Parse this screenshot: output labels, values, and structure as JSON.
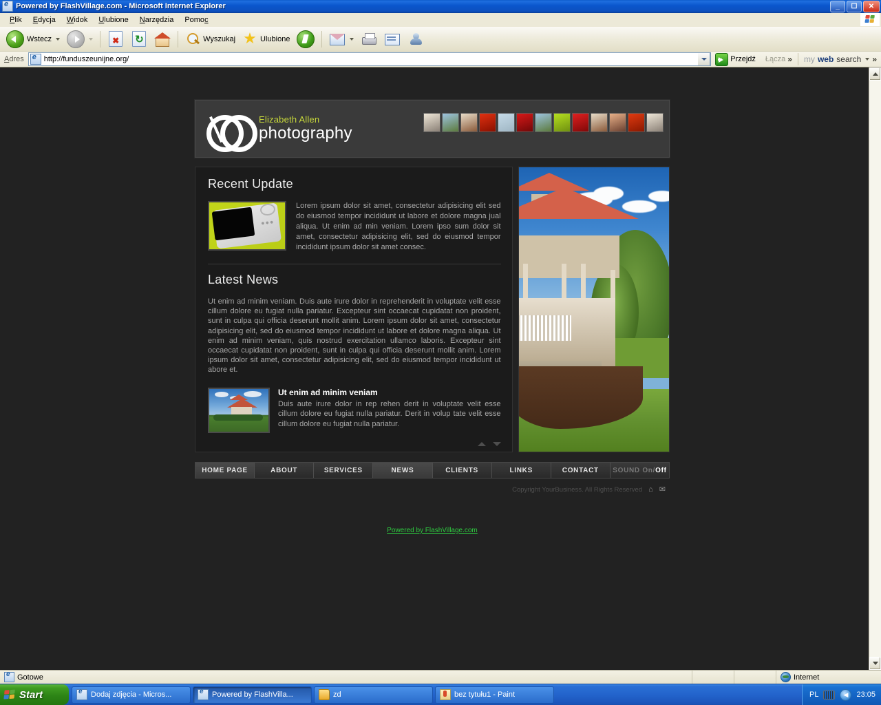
{
  "window": {
    "title": "Powered by FlashVillage.com - Microsoft Internet Explorer",
    "minimize_label": "–",
    "maximize_label": "❐",
    "close_label": "✕"
  },
  "menu": {
    "items": [
      {
        "label": "Plik",
        "accel": "P"
      },
      {
        "label": "Edycja",
        "accel": "E"
      },
      {
        "label": "Widok",
        "accel": "W"
      },
      {
        "label": "Ulubione",
        "accel": "U"
      },
      {
        "label": "Narzędzia",
        "accel": "N"
      },
      {
        "label": "Pomoc",
        "accel": "c"
      }
    ]
  },
  "toolbar": {
    "back_label": "Wstecz",
    "search_label": "Wyszukaj",
    "favorites_label": "Ulubione",
    "icons": [
      "back-icon",
      "forward-icon",
      "stop-icon",
      "refresh-icon",
      "home-icon",
      "search-icon",
      "favorites-star-icon",
      "media-icon",
      "mail-icon",
      "print-icon",
      "edit-icon",
      "messenger-icon"
    ]
  },
  "address": {
    "label": "Adres",
    "url": "http://funduszeunijne.org/",
    "go_label": "Przejdź",
    "links_label": "Łącza",
    "chevron": "»",
    "mywebsearch": {
      "part1": "my",
      "part2": "web",
      "part3": "search"
    }
  },
  "site": {
    "header": {
      "brand_name": "Elizabeth Allen",
      "brand_word": "photography",
      "thumbnails": [
        {
          "colors": "#efe7d8,#8a8076"
        },
        {
          "colors": "#9ec4e0,#5b7a3c"
        },
        {
          "colors": "#e8dcc8,#8a5a3a"
        },
        {
          "colors": "#e03010,#8a1000"
        },
        {
          "colors": "#c6dbe8,#9fb6c4"
        },
        {
          "colors": "#d81818,#700808"
        },
        {
          "colors": "#9ec4e0,#5b7a3c"
        },
        {
          "colors": "#b6e020,#6f9010"
        },
        {
          "colors": "#e02020,#800808"
        },
        {
          "colors": "#e8dcc8,#8a5a3a"
        },
        {
          "colors": "#e8b088,#6a4030"
        },
        {
          "colors": "#e03a10,#8a1800"
        },
        {
          "colors": "#efe7d8,#8a8076"
        }
      ]
    },
    "recent_update": {
      "title": "Recent Update",
      "body": "Lorem ipsum dolor sit amet, consectetur adipisicing elit sed do eiusmod tempor incididunt ut labore et dolore magna jual aliqua. Ut enim ad min veniam. Lorem ipso sum dolor sit amet, consectetur adipisicing elit, sed do eiusmod tempor incididunt ipsum dolor sit amet consec."
    },
    "latest_news": {
      "title": "Latest News",
      "body": "Ut enim ad minim veniam. Duis aute irure dolor in reprehenderit in voluptate velit esse cillum dolore eu fugiat nulla pariatur. Excepteur sint occaecat cupidatat non proident, sunt in culpa qui officia deserunt mollit anim. Lorem ipsum dolor sit amet, consectetur adipisicing elit, sed do eiusmod tempor incididunt ut labore et dolore magna aliqua. Ut enim ad minim veniam, quis nostrud exercitation ullamco laboris. Excepteur sint occaecat cupidatat non proident, sunt in culpa qui officia deserunt mollit anim. Lorem ipsum dolor sit amet, consectetur adipisicing elit, sed do eiusmod tempor incididunt ut abore et.",
      "item": {
        "title": "Ut enim ad minim veniam",
        "desc": "Duis aute irure dolor in rep rehen derit in voluptate velit esse cillum dolore eu fugiat nulla pariatur. Derit in volup tate velit esse cillum dolore eu fugiat nulla pariatur."
      }
    },
    "nav": [
      {
        "label": "HOME PAGE",
        "active": true
      },
      {
        "label": "ABOUT",
        "active": false
      },
      {
        "label": "SERVICES",
        "active": false
      },
      {
        "label": "NEWS",
        "active": true
      },
      {
        "label": "CLIENTS",
        "active": false
      },
      {
        "label": "LINKS",
        "active": false
      },
      {
        "label": "CONTACT",
        "active": false
      }
    ],
    "sound": {
      "prefix": "SOUND On/",
      "state": "Off"
    },
    "copyright": "Copyright YourBusiness. All Rights Reserved",
    "copy_icons": [
      "home-icon",
      "mail-icon"
    ],
    "powered_by": "Powered by FlashVillage.com",
    "accent_green": "#2ecc40",
    "brand_yellow": "#c8d93a"
  },
  "statusbar": {
    "status": "Gotowe",
    "zone": "Internet"
  },
  "taskbar": {
    "start_label": "Start",
    "tasks": [
      {
        "label": "Dodaj zdjęcia - Micros...",
        "icon": "ie-icon",
        "active": false
      },
      {
        "label": "Powered by FlashVilla...",
        "icon": "ie-icon",
        "active": true
      },
      {
        "label": "zd",
        "icon": "folder-icon",
        "active": false
      },
      {
        "label": "bez tytułu1 - Paint",
        "icon": "paint-icon",
        "active": false
      }
    ],
    "tray": {
      "language": "PL",
      "clock": "23:05"
    }
  }
}
